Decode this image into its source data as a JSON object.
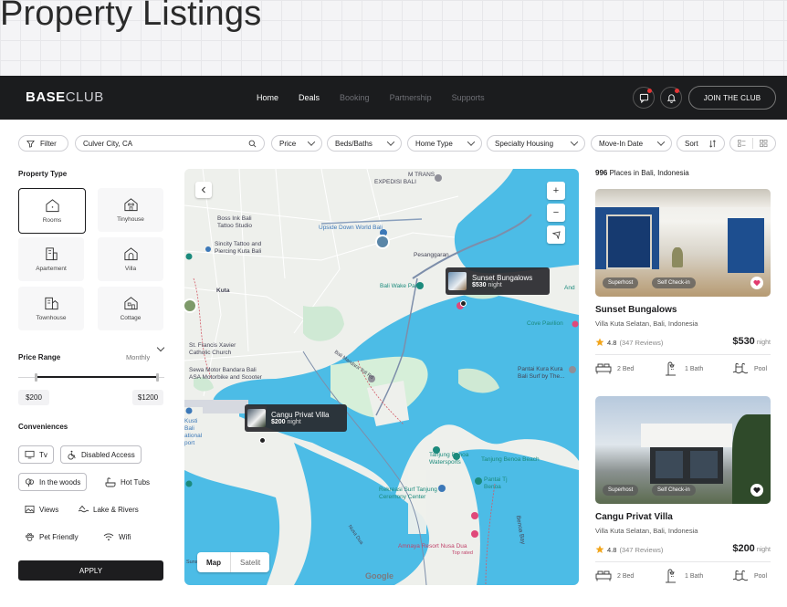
{
  "page_title": "Property Listings",
  "nav": {
    "logo_bold": "BASE",
    "logo_light": "CLUB",
    "links": [
      "Home",
      "Deals",
      "Booking",
      "Partnership",
      "Supports"
    ],
    "join_label": "JOIN THE CLUB"
  },
  "filters": {
    "filter_label": "Filter",
    "search_value": "Culver City, CA",
    "price": "Price",
    "beds": "Beds/Baths",
    "home_type": "Home Type",
    "specialty": "Specialty Housing",
    "move_in": "Move-In Date",
    "sort": "Sort"
  },
  "sidebar": {
    "property_type_title": "Property Type",
    "types": [
      "Rooms",
      "Tinyhouse",
      "Apartement",
      "Villa",
      "Townhouse",
      "Cottage"
    ],
    "price_range_title": "Price Range",
    "price_period": "Monthly",
    "price_min": "$200",
    "price_max": "$1200",
    "slider_min_fraction": 0.12,
    "slider_max_fraction": 0.95,
    "conveniences_title": "Conveniences",
    "conveniences": [
      "Tv",
      "Disabled Access",
      "In the woods",
      "Hot Tubs",
      "Views",
      "Lake & Rivers",
      "Pet Friendly",
      "Wifi"
    ],
    "apply_label": "APPLY"
  },
  "map": {
    "zoom_in": "+",
    "zoom_out": "−",
    "tab_map": "Map",
    "tab_satellite": "Satelit",
    "google": "Google",
    "labels": {
      "m_trans": "M TRANS",
      "expedisi": "EXPEDISI BALI",
      "boss_ink": "Boss Ink Bali",
      "tattoo": "Tattoo Studio",
      "upside": "Upside Down World Bali",
      "sincity": "Sincity Tattoo and",
      "piercing": "Piercing Kuta Bali",
      "pesanggaran": "Pesanggaran",
      "kuta": "Kuta",
      "wake_park": "Bali Wake Park",
      "cove": "Cove Pavilion",
      "st_francis": "St. Francis Xavier",
      "catholic": "Catholic Church",
      "sewa": "Sewa Motor Bandara Bali",
      "asa": "ASA Motorbike and Scooter",
      "pantai": "Pantai Kura Kura",
      "serangan": "Bali Surf by The...",
      "tanjung_water": "Tanjung Benoa",
      "watersports": "Watersports",
      "tanjung_beach": "Tanjung Benoa Beach",
      "pantai_tj": "Pantai Tj",
      "benoa": "Benoa",
      "rekreasi": "Rekreasi Surf Tanjung",
      "ceremony": "Ceremony Center",
      "amnaya": "Amnaya Resort Nusa Dua",
      "top_rated": "Top rated",
      "bali_bay": "Benoa Bay",
      "and": "And",
      "sunset_road": "Jl. Sunset Road",
      "toll": "Bali Mandara Toll Rd",
      "sunset": "Sunset",
      "nusa_dua": "Nusa Dua",
      "kusti": "Kusti",
      "bali": "Bali",
      "national": "ational",
      "port": "port"
    },
    "popups": [
      {
        "title": "Sunset Bungalows",
        "price": "$530",
        "unit": "night"
      },
      {
        "title": "Cangu Privat Villa",
        "price": "$200",
        "unit": "night"
      }
    ]
  },
  "results": {
    "count": "996",
    "location_text": "Places in Bali, Indonesia",
    "listings": [
      {
        "title": "Sunset Bungalows",
        "location": "Villa Kuta Selatan, Bali, Indonesia",
        "rating": "4.8",
        "reviews": "(347 Reviews)",
        "price": "$530",
        "unit": "night",
        "badges": [
          "Superhost",
          "Self Check-in"
        ],
        "bed": "2 Bed",
        "bath": "1 Bath",
        "pool": "Pool",
        "favorite": true
      },
      {
        "title": "Cangu Privat Villa",
        "location": "Villa Kuta Selatan, Bali, Indonesia",
        "rating": "4.8",
        "reviews": "(347 Reviews)",
        "price": "$200",
        "unit": "night",
        "badges": [
          "Superhost",
          "Self Check-in"
        ],
        "bed": "2 Bed",
        "bath": "1 Bath",
        "pool": "Pool",
        "favorite": false
      }
    ]
  },
  "colors": {
    "nav_bg": "#1b1c1e",
    "water": "#4fbde8",
    "star": "#f2a51a",
    "heart": "#e23a6e"
  }
}
